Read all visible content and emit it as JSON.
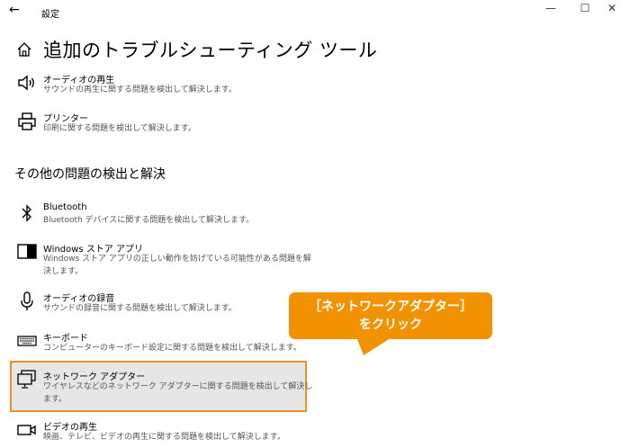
{
  "window": {
    "title": "設定",
    "back_label": "←",
    "minimize": "—",
    "maximize": "☐",
    "close": "✕"
  },
  "page": {
    "title": "追加のトラブルシューティング ツール",
    "section_title": "その他の問題の検出と解決"
  },
  "items": [
    {
      "title": "オーディオの再生",
      "desc": "サウンドの再生に関する問題を検出して解決します。",
      "icon": "speaker-icon"
    },
    {
      "title": "プリンター",
      "desc": "印刷に関する問題を検出して解決します。",
      "icon": "printer-icon"
    },
    {
      "title": "Bluetooth",
      "desc": "Bluetooth デバイスに関する問題を検出して解決します。",
      "icon": "bluetooth-icon"
    },
    {
      "title": "Windows ストア アプリ",
      "desc": "Windows ストア アプリの正しい動作を妨げている可能性がある問題を解決します。",
      "icon": "store-icon"
    },
    {
      "title": "オーディオの録音",
      "desc": "サウンドの録音に関する問題を検出して解決します。",
      "icon": "microphone-icon"
    },
    {
      "title": "キーボード",
      "desc": "コンピューターのキーボード設定に関する問題を検出して解決します。",
      "icon": "keyboard-icon"
    },
    {
      "title": "ネットワーク アダプター",
      "desc": "ワイヤレスなどのネットワーク アダプターに関する問題を検出して解決します。",
      "icon": "network-adapter-icon"
    },
    {
      "title": "ビデオの再生",
      "desc": "映画、テレビ、ビデオの再生に関する問題を検出して解決します。",
      "icon": "video-icon"
    }
  ],
  "callout": {
    "line1": "［ネットワークアダプター］",
    "line2": "をクリック"
  },
  "colors": {
    "callout": "#f39200",
    "highlight_border": "#f0901e",
    "highlight_bg": "#e6e6e6"
  }
}
